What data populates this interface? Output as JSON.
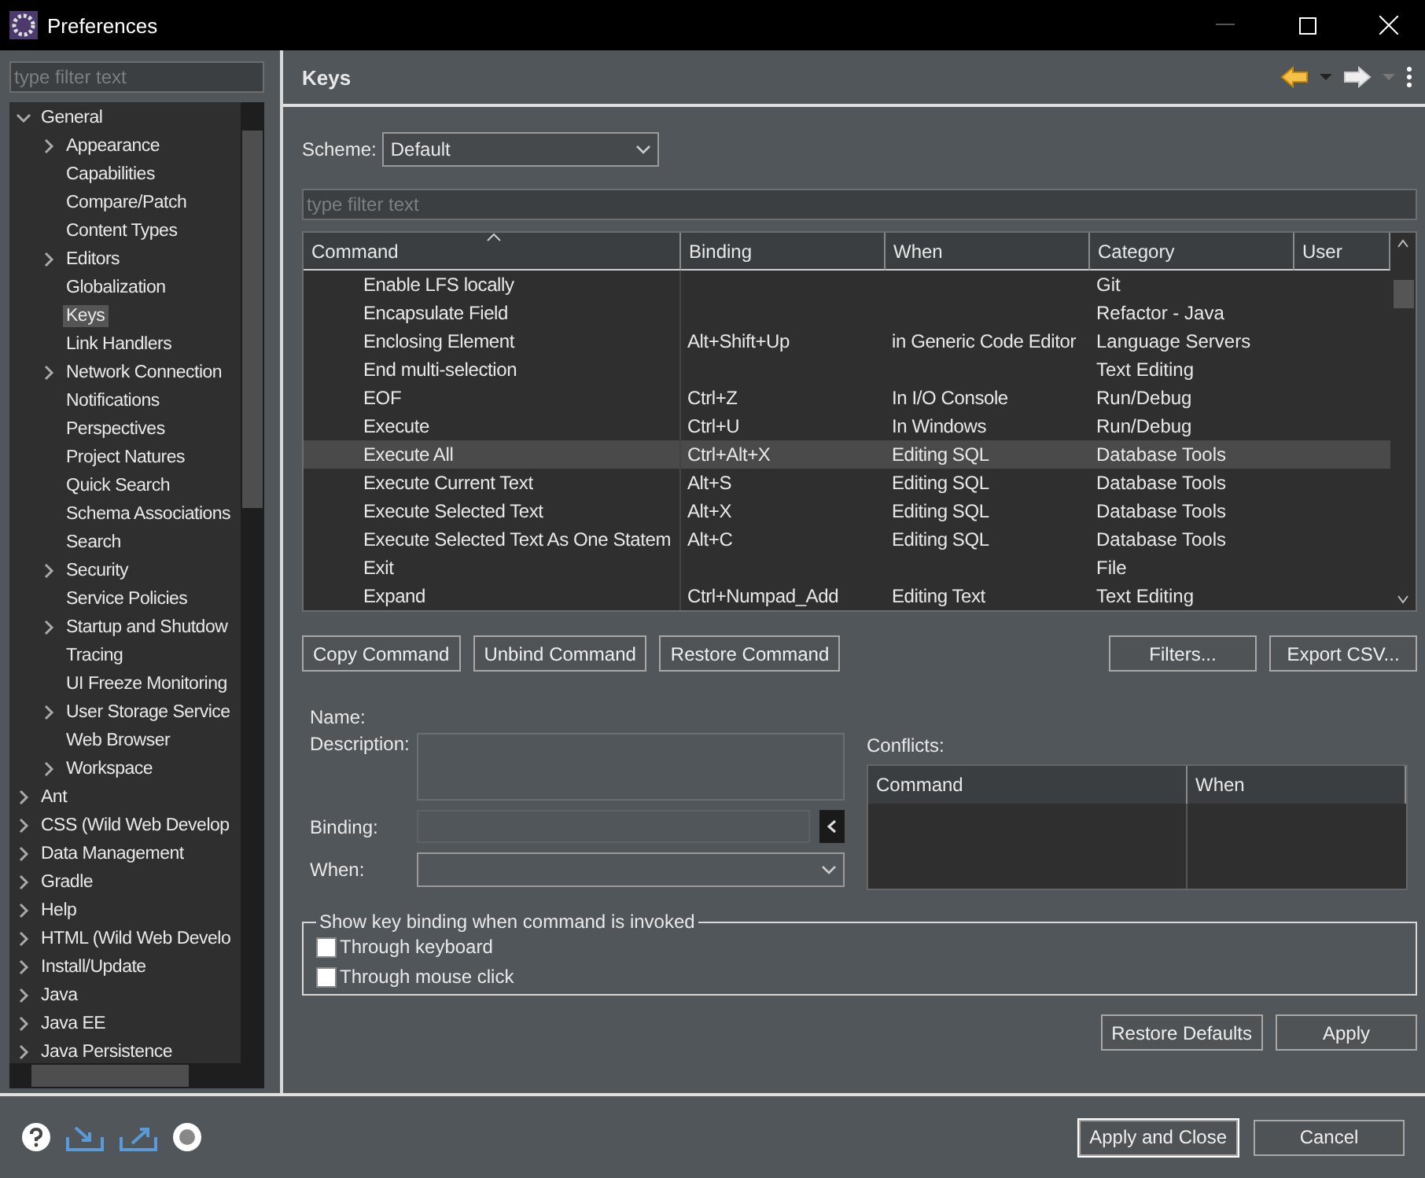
{
  "window": {
    "title": "Preferences"
  },
  "sidebar": {
    "filter": {
      "placeholder": "type filter text"
    },
    "tree": [
      {
        "label": "General",
        "expanded": true,
        "selected": false,
        "children": [
          {
            "label": "Appearance",
            "expanded": false,
            "selected": false
          },
          {
            "label": "Capabilities",
            "selected": false
          },
          {
            "label": "Compare/Patch",
            "selected": false
          },
          {
            "label": "Content Types",
            "selected": false
          },
          {
            "label": "Editors",
            "expanded": false,
            "selected": false
          },
          {
            "label": "Globalization",
            "selected": false
          },
          {
            "label": "Keys",
            "selected": true
          },
          {
            "label": "Link Handlers",
            "selected": false
          },
          {
            "label": "Network Connection",
            "expanded": false,
            "selected": false
          },
          {
            "label": "Notifications",
            "selected": false
          },
          {
            "label": "Perspectives",
            "selected": false
          },
          {
            "label": "Project Natures",
            "selected": false
          },
          {
            "label": "Quick Search",
            "selected": false
          },
          {
            "label": "Schema Associations",
            "selected": false
          },
          {
            "label": "Search",
            "selected": false
          },
          {
            "label": "Security",
            "expanded": false,
            "selected": false
          },
          {
            "label": "Service Policies",
            "selected": false
          },
          {
            "label": "Startup and Shutdow",
            "expanded": false,
            "selected": false
          },
          {
            "label": "Tracing",
            "selected": false
          },
          {
            "label": "UI Freeze Monitoring",
            "selected": false
          },
          {
            "label": "User Storage Service",
            "expanded": false,
            "selected": false
          },
          {
            "label": "Web Browser",
            "selected": false
          },
          {
            "label": "Workspace",
            "expanded": false,
            "selected": false
          }
        ]
      },
      {
        "label": "Ant",
        "expanded": false,
        "selected": false
      },
      {
        "label": "CSS (Wild Web Develop",
        "expanded": false,
        "selected": false
      },
      {
        "label": "Data Management",
        "expanded": false,
        "selected": false
      },
      {
        "label": "Gradle",
        "expanded": false,
        "selected": false
      },
      {
        "label": "Help",
        "expanded": false,
        "selected": false
      },
      {
        "label": "HTML (Wild Web Develo",
        "expanded": false,
        "selected": false
      },
      {
        "label": "Install/Update",
        "expanded": false,
        "selected": false
      },
      {
        "label": "Java",
        "expanded": false,
        "selected": false
      },
      {
        "label": "Java EE",
        "expanded": false,
        "selected": false
      },
      {
        "label": "Java Persistence",
        "expanded": false,
        "selected": false
      }
    ]
  },
  "page": {
    "title": "Keys",
    "scheme": {
      "label": "Scheme:",
      "value": "Default"
    },
    "filter": {
      "placeholder": "type filter text"
    },
    "table": {
      "columns": [
        "Command",
        "Binding",
        "When",
        "Category",
        "User"
      ],
      "rows": [
        {
          "cells": [
            "Enable LFS locally",
            "",
            "",
            "Git",
            ""
          ],
          "selected": false
        },
        {
          "cells": [
            "Encapsulate Field",
            "",
            "",
            "Refactor - Java",
            ""
          ],
          "selected": false
        },
        {
          "cells": [
            "Enclosing Element",
            "Alt+Shift+Up",
            "in Generic Code Editor",
            "Language Servers",
            ""
          ],
          "selected": false
        },
        {
          "cells": [
            "End multi-selection",
            "",
            "",
            "Text Editing",
            ""
          ],
          "selected": false
        },
        {
          "cells": [
            "EOF",
            "Ctrl+Z",
            "In I/O Console",
            "Run/Debug",
            ""
          ],
          "selected": false
        },
        {
          "cells": [
            "Execute",
            "Ctrl+U",
            "In Windows",
            "Run/Debug",
            ""
          ],
          "selected": false
        },
        {
          "cells": [
            "Execute All",
            "Ctrl+Alt+X",
            "Editing SQL",
            "Database Tools",
            ""
          ],
          "selected": true
        },
        {
          "cells": [
            "Execute Current Text",
            "Alt+S",
            "Editing SQL",
            "Database Tools",
            ""
          ],
          "selected": false
        },
        {
          "cells": [
            "Execute Selected Text",
            "Alt+X",
            "Editing SQL",
            "Database Tools",
            ""
          ],
          "selected": false
        },
        {
          "cells": [
            "Execute Selected Text As One Statem",
            "Alt+C",
            "Editing SQL",
            "Database Tools",
            ""
          ],
          "selected": false
        },
        {
          "cells": [
            "Exit",
            "",
            "",
            "File",
            ""
          ],
          "selected": false
        },
        {
          "cells": [
            "Expand",
            "Ctrl+Numpad_Add",
            "Editing Text",
            "Text Editing",
            ""
          ],
          "selected": false
        }
      ]
    },
    "left_buttons": [
      "Copy Command",
      "Unbind Command",
      "Restore Command"
    ],
    "right_buttons": [
      "Filters...",
      "Export CSV..."
    ],
    "name_label": "Name:",
    "description_label": "Description:",
    "binding_label": "Binding:",
    "when_label": "When:",
    "conflicts": {
      "label": "Conflicts:",
      "columns": [
        "Command",
        "When"
      ]
    },
    "show_group": {
      "title": "Show key binding when command is invoked",
      "options": [
        {
          "label": "Through keyboard",
          "checked": false
        },
        {
          "label": "Through mouse click",
          "checked": false
        }
      ]
    },
    "page_buttons": [
      "Restore Defaults",
      "Apply"
    ]
  },
  "footer_buttons": [
    {
      "label": "Apply and Close",
      "default": true
    },
    {
      "label": "Cancel",
      "default": false
    }
  ]
}
